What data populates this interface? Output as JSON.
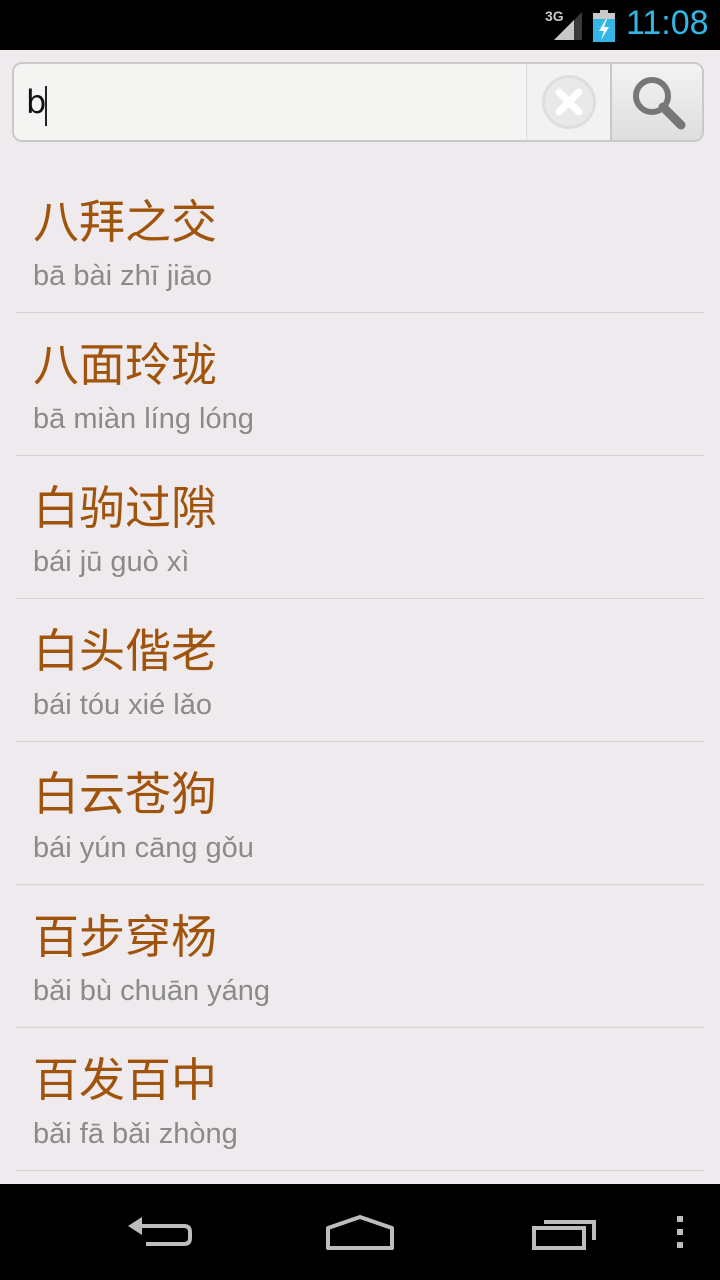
{
  "status_bar": {
    "network": "3G",
    "time": "11:08",
    "signal_icon": "signal-icon",
    "battery_icon": "battery-charging-icon",
    "time_color": "#33b5e5"
  },
  "search": {
    "query": "b",
    "clear_icon": "clear-icon",
    "search_icon": "search-icon"
  },
  "results": [
    {
      "idiom": "八拜之交",
      "pinyin": "bā bài zhī jiāo"
    },
    {
      "idiom": "八面玲珑",
      "pinyin": "bā miàn líng lóng"
    },
    {
      "idiom": "白驹过隙",
      "pinyin": "bái jū guò xì"
    },
    {
      "idiom": "白头偕老",
      "pinyin": "bái tóu xié lǎo"
    },
    {
      "idiom": "白云苍狗",
      "pinyin": "bái yún cāng gǒu"
    },
    {
      "idiom": "百步穿杨",
      "pinyin": "bǎi bù chuān yáng"
    },
    {
      "idiom": "百发百中",
      "pinyin": "bǎi fā bǎi zhòng"
    }
  ],
  "colors": {
    "idiom_text": "#a0530a",
    "pinyin_text": "#8a8a8a",
    "background": "#efeaed"
  },
  "nav_bar": {
    "back_icon": "back-icon",
    "home_icon": "home-icon",
    "recents_icon": "recents-icon",
    "menu_icon": "overflow-menu-icon"
  }
}
